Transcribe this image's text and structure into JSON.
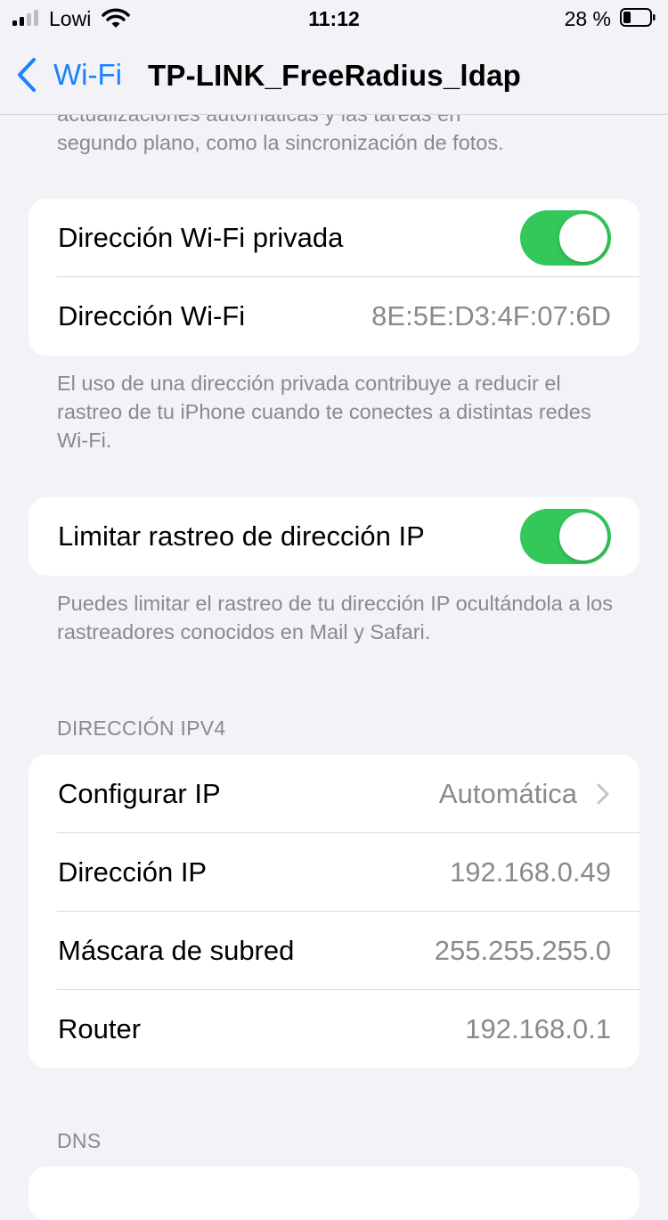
{
  "status_bar": {
    "carrier": "Lowi",
    "time": "11:12",
    "battery_percent": "28 %"
  },
  "nav": {
    "back_label": "Wi-Fi",
    "title": "TP-LINK_FreeRadius_ldap"
  },
  "top_footnote": {
    "line1": "actualizaciones automáticas y las tareas en",
    "line2": "segundo plano, como la sincronización de fotos."
  },
  "private_address_group": {
    "toggle_label": "Dirección Wi-Fi privada",
    "toggle_on": true,
    "address_label": "Dirección Wi-Fi",
    "address_value": "8E:5E:D3:4F:07:6D"
  },
  "private_address_footnote": "El uso de una dirección privada contribuye a reducir el rastreo de tu iPhone cuando te conectes a distintas redes Wi-Fi.",
  "ip_tracking_group": {
    "toggle_label": "Limitar rastreo de dirección IP",
    "toggle_on": true
  },
  "ip_tracking_footnote": "Puedes limitar el rastreo de tu dirección IP ocultándola a los rastreadores conocidos en Mail y Safari.",
  "ipv4": {
    "header": "DIRECCIÓN IPV4",
    "configure_label": "Configurar IP",
    "configure_value": "Automática",
    "ip_label": "Dirección IP",
    "ip_value": "192.168.0.49",
    "subnet_label": "Máscara de subred",
    "subnet_value": "255.255.255.0",
    "router_label": "Router",
    "router_value": "192.168.0.1"
  },
  "dns": {
    "header": "DNS"
  },
  "colors": {
    "accent": "#1a82fb",
    "toggle_on": "#34c759",
    "background": "#f2f2f7",
    "secondary_text": "#8a8a8e"
  },
  "icons": [
    "signal-icon",
    "wifi-icon",
    "battery-icon",
    "chevron-left-icon",
    "chevron-right-icon"
  ]
}
